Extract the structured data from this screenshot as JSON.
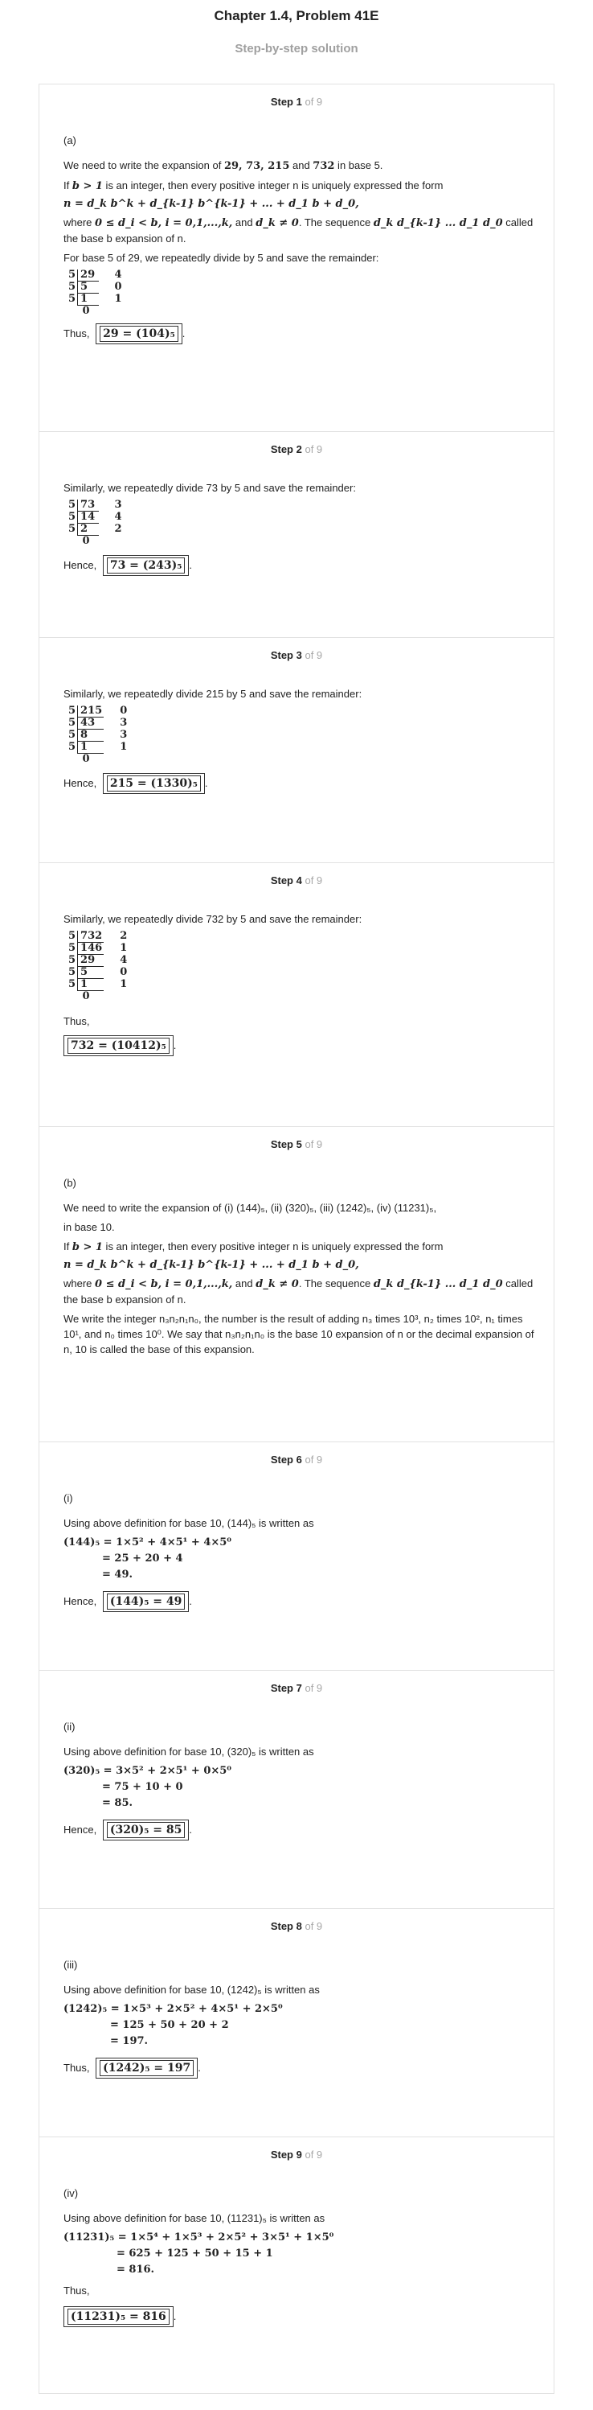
{
  "header": {
    "title": "Chapter 1.4, Problem 41E",
    "subtitle": "Step-by-step solution"
  },
  "steps": [
    {
      "label": "Step 1",
      "of": "of 9",
      "part": "(a)",
      "intro_pre": "We need to write the expansion of ",
      "intro_nums": "29, 73, 215",
      "intro_and": " and ",
      "intro_num2": "732",
      "intro_post": " in base 5.",
      "def_pre": "If ",
      "def_cond": "b > 1",
      "def_post": " is an integer, then every positive integer n is uniquely expressed the form",
      "formula": "n = d_k b^k + d_{k-1} b^{k-1} + ... + d_1 b + d_0,",
      "where_pre": "where ",
      "where_cond": "0 ≤ d_i < b, i = 0,1,...,k,",
      "where_and": " and ",
      "where_cond2": "d_k ≠ 0",
      "where_post": ". The sequence ",
      "where_seq": "d_k d_{k-1} ... d_1 d_0",
      "where_end": " called the base b expansion of n.",
      "note": "For base 5 of 29, we repeatedly divide by 5 and save the remainder:",
      "division": {
        "divisor": "5",
        "rows": [
          [
            "29",
            "4"
          ],
          [
            "5",
            "0"
          ],
          [
            "1",
            "1"
          ]
        ],
        "final": "0"
      },
      "result_lead": "Thus,",
      "result": "29 = (104)₅"
    },
    {
      "label": "Step 2",
      "of": "of 9",
      "note": "Similarly, we repeatedly divide 73 by 5 and save the remainder:",
      "division": {
        "divisor": "5",
        "rows": [
          [
            "73",
            "3"
          ],
          [
            "14",
            "4"
          ],
          [
            "2",
            "2"
          ]
        ],
        "final": "0"
      },
      "result_lead": "Hence,",
      "result": "73 = (243)₅"
    },
    {
      "label": "Step 3",
      "of": "of 9",
      "note": "Similarly, we repeatedly divide 215 by 5 and save the remainder:",
      "division": {
        "divisor": "5",
        "rows": [
          [
            "215",
            "0"
          ],
          [
            "43",
            "3"
          ],
          [
            "8",
            "3"
          ],
          [
            "1",
            "1"
          ]
        ],
        "final": "0"
      },
      "result_lead": "Hence,",
      "result": "215 = (1330)₅"
    },
    {
      "label": "Step 4",
      "of": "of 9",
      "note": "Similarly, we repeatedly divide 732 by 5 and save the remainder:",
      "division": {
        "divisor": "5",
        "rows": [
          [
            "732",
            "2"
          ],
          [
            "146",
            "1"
          ],
          [
            "29",
            "4"
          ],
          [
            "5",
            "0"
          ],
          [
            "1",
            "1"
          ]
        ],
        "final": "0"
      },
      "result_lead": "Thus,",
      "result": "732 = (10412)₅"
    },
    {
      "label": "Step 5",
      "of": "of 9",
      "part": "(b)",
      "intro": "We need to write the expansion of (i) (144)₅, (ii) (320)₅, (iii) (1242)₅, (iv) (11231)₅,",
      "intro2": "in base 10.",
      "def_pre": "If ",
      "def_cond": "b > 1",
      "def_post": " is an integer, then every positive integer n is uniquely expressed the form",
      "formula": "n = d_k b^k + d_{k-1} b^{k-1} + ... + d_1 b + d_0,",
      "where_pre": "where ",
      "where_cond": "0 ≤ d_i < b, i = 0,1,...,k,",
      "where_and": " and ",
      "where_cond2": "d_k ≠ 0",
      "where_post": ". The sequence ",
      "where_seq": "d_k d_{k-1} ... d_1 d_0",
      "where_end": " called the base b expansion of n.",
      "para": "We write the integer n₃n₂n₁n₀, the number is the result of adding n₃ times 10³, n₂ times 10², n₁ times 10¹, and n₀ times 10⁰. We say that n₃n₂n₁n₀ is the base 10 expansion of n or the decimal expansion of n, 10 is called the base of this expansion."
    },
    {
      "label": "Step 6",
      "of": "of 9",
      "part": "(i)",
      "lead": "Using above definition for base 10, (144)₅ is written as",
      "lines": [
        "(144)₅ = 1×5² + 4×5¹ + 4×5⁰",
        "= 25 + 20 + 4",
        "= 49."
      ],
      "result_lead": "Hence,",
      "result": "(144)₅ = 49"
    },
    {
      "label": "Step 7",
      "of": "of 9",
      "part": "(ii)",
      "lead": "Using above definition for base 10, (320)₅ is written as",
      "lines": [
        "(320)₅ = 3×5² + 2×5¹ + 0×5⁰",
        "= 75 + 10 + 0",
        "= 85."
      ],
      "result_lead": "Hence,",
      "result": "(320)₅ = 85"
    },
    {
      "label": "Step 8",
      "of": "of 9",
      "part": "(iii)",
      "lead": "Using above definition for base 10, (1242)₅ is written as",
      "lines": [
        "(1242)₅ = 1×5³ + 2×5² + 4×5¹ + 2×5⁰",
        "= 125 + 50 + 20 + 2",
        "= 197."
      ],
      "result_lead": "Thus,",
      "result": "(1242)₅ = 197"
    },
    {
      "label": "Step 9",
      "of": "of 9",
      "part": "(iv)",
      "lead": "Using above definition for base 10, (11231)₅ is written as",
      "lines": [
        "(11231)₅ = 1×5⁴ + 1×5³ + 2×5² + 3×5¹ + 1×5⁰",
        "= 625 + 125 + 50 + 15 + 1",
        "= 816."
      ],
      "result_lead": "Thus,",
      "result": "(11231)₅ = 816"
    }
  ]
}
